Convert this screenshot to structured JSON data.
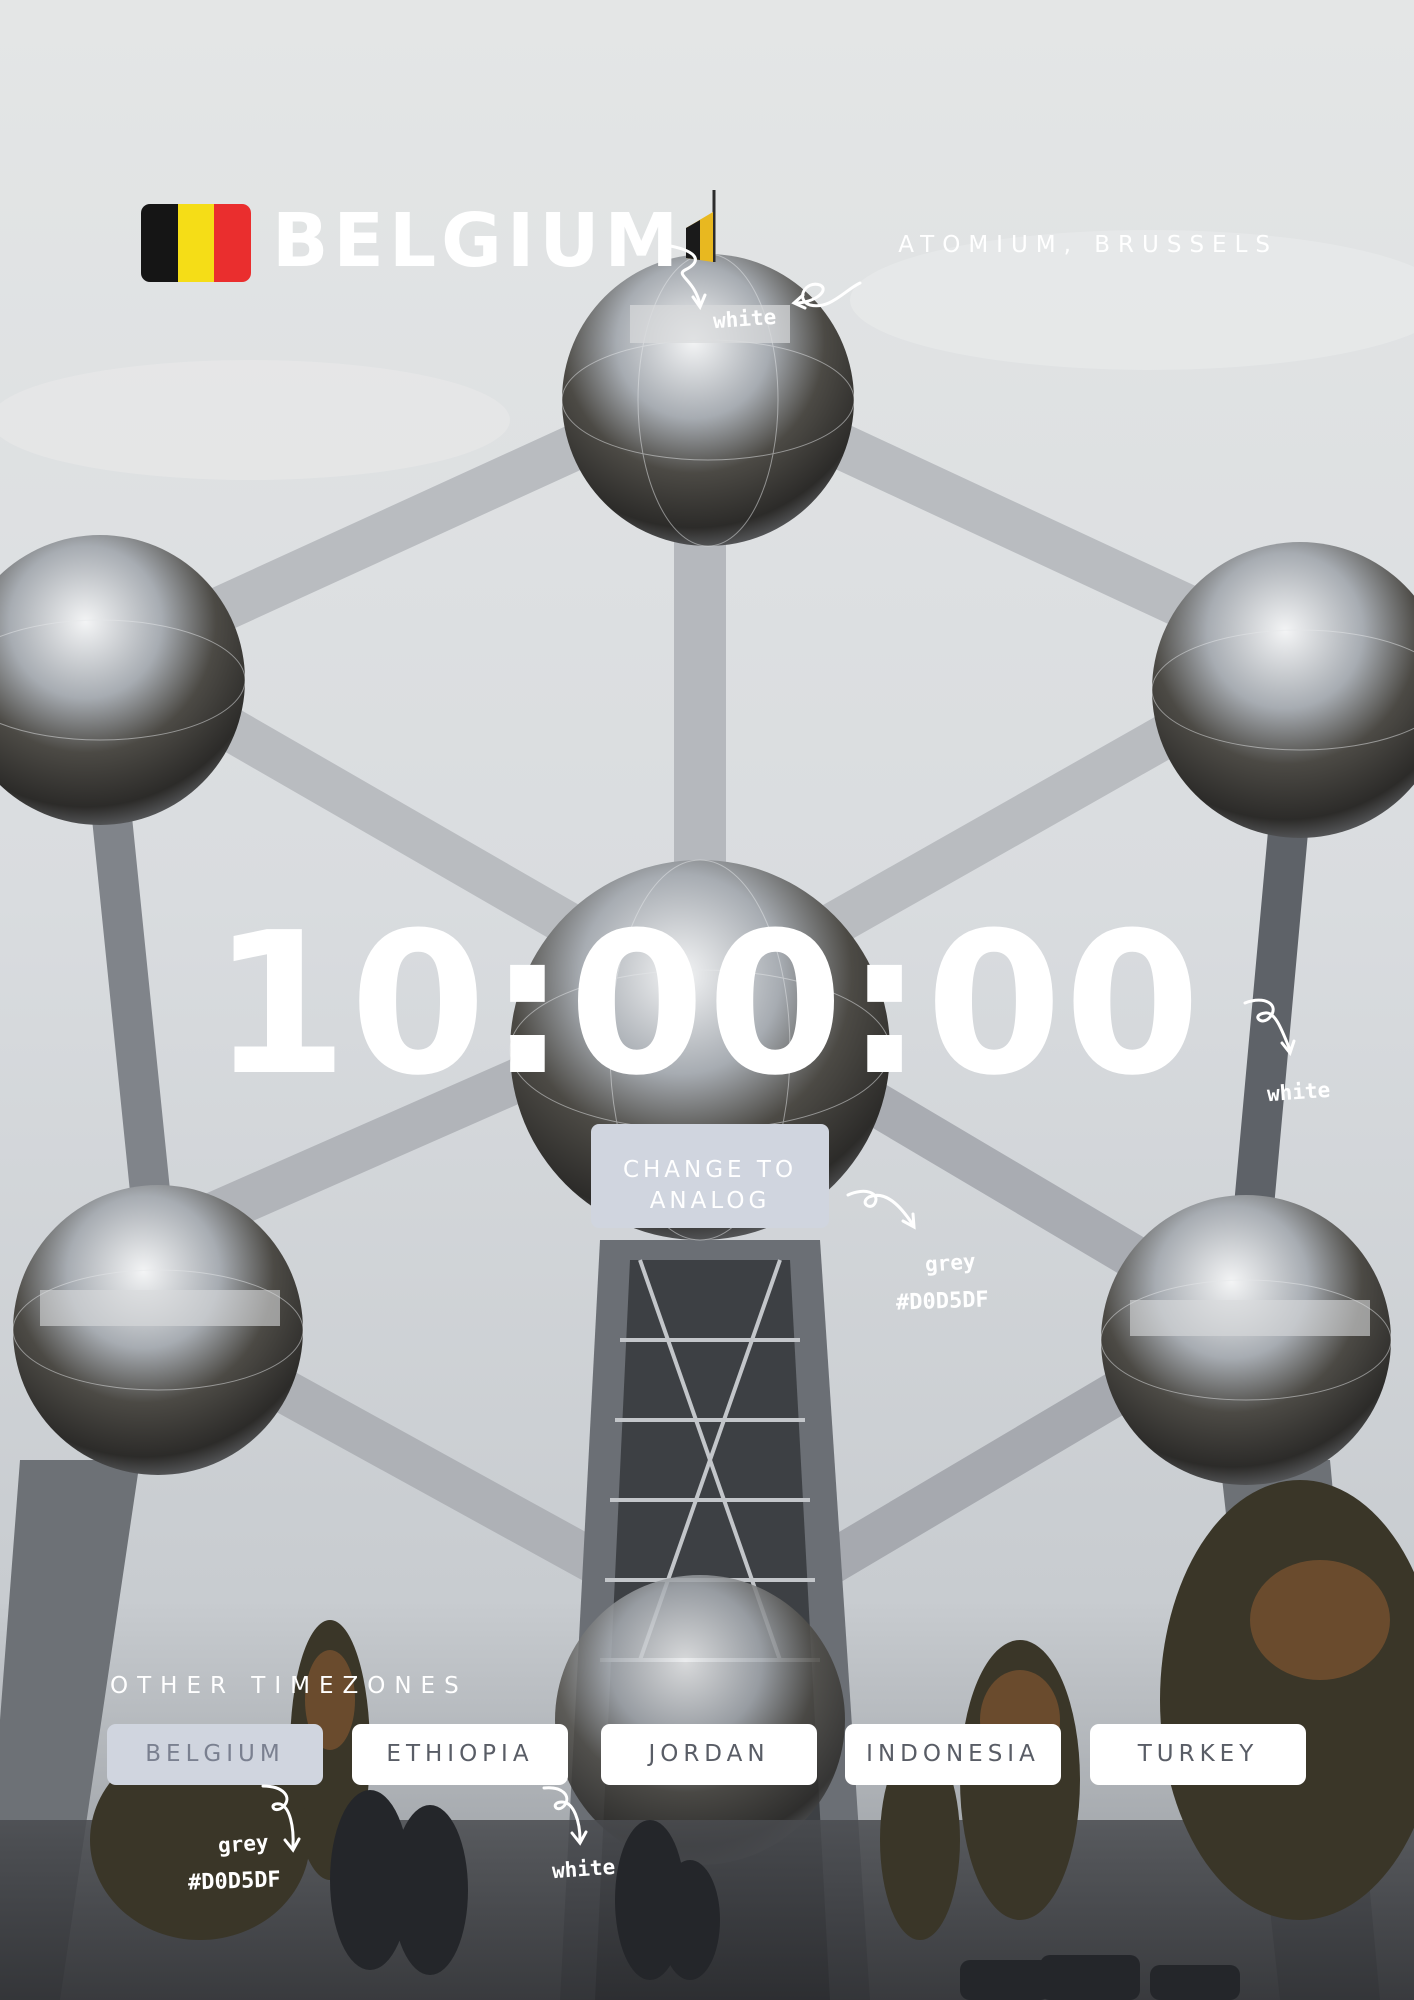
{
  "header": {
    "title": "BELGIUM",
    "location": "ATOMIUM, BRUSSELS",
    "flag_colors": [
      "#151515",
      "#f5dd17",
      "#ea2e2e"
    ]
  },
  "clock": {
    "time": "10:00:00",
    "toggle_label": "CHANGE TO\nANALOG"
  },
  "timezones": {
    "label": "OTHER TIMEZONES",
    "tabs": [
      {
        "label": "BELGIUM",
        "active": true
      },
      {
        "label": "ETHIOPIA",
        "active": false
      },
      {
        "label": "JORDAN",
        "active": false
      },
      {
        "label": "INDONESIA",
        "active": false
      },
      {
        "label": "TURKEY",
        "active": false
      }
    ]
  },
  "annotations": {
    "title_note": "white",
    "clock_note": "white",
    "button_note_name": "grey",
    "button_note_hex": "#D0D5DF",
    "tab_active_note_name": "grey",
    "tab_active_note_hex": "#D0D5DF",
    "tab_inactive_note": "white"
  },
  "colors": {
    "accent_grey": "#D0D5DF",
    "text_white": "#FFFFFF"
  }
}
